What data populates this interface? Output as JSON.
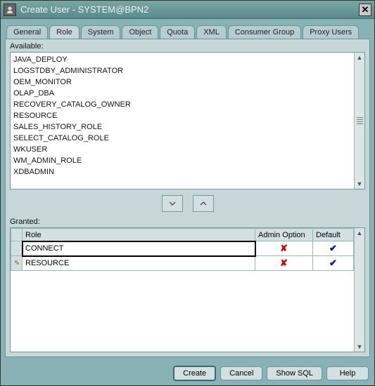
{
  "window": {
    "title": "Create User - SYSTEM@BPN2"
  },
  "tabs": [
    {
      "label": "General"
    },
    {
      "label": "Role"
    },
    {
      "label": "System"
    },
    {
      "label": "Object"
    },
    {
      "label": "Quota"
    },
    {
      "label": "XML"
    },
    {
      "label": "Consumer Group"
    },
    {
      "label": "Proxy Users"
    }
  ],
  "activeTab": 1,
  "available_label": "Available:",
  "available_roles": [
    "JAVA_DEPLOY",
    "LOGSTDBY_ADMINISTRATOR",
    "OEM_MONITOR",
    "OLAP_DBA",
    "RECOVERY_CATALOG_OWNER",
    "RESOURCE",
    "SALES_HISTORY_ROLE",
    "SELECT_CATALOG_ROLE",
    "WKUSER",
    "WM_ADMIN_ROLE",
    "XDBADMIN"
  ],
  "granted_label": "Granted:",
  "granted_headers": {
    "role": "Role",
    "admin": "Admin Option",
    "default": "Default"
  },
  "granted_rows": [
    {
      "role": "CONNECT",
      "admin": "✘",
      "default": "✔",
      "edited": false,
      "selected": true
    },
    {
      "role": "RESOURCE",
      "admin": "✘",
      "default": "✔",
      "edited": true,
      "selected": false
    }
  ],
  "buttons": {
    "create": "Create",
    "cancel": "Cancel",
    "showsql": "Show SQL",
    "help": "Help"
  }
}
